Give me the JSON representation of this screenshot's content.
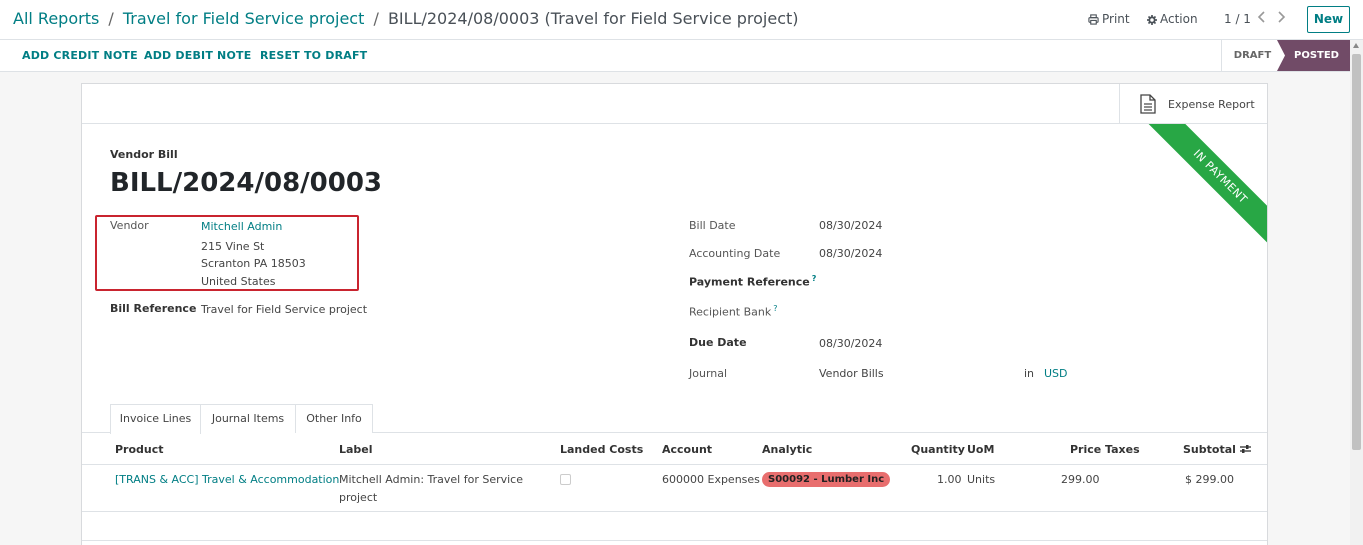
{
  "breadcrumb": {
    "root": "All Reports",
    "parent": "Travel for Field Service project",
    "current": "BILL/2024/08/0003 (Travel for Field Service project)",
    "separator": "/"
  },
  "toolbar": {
    "print_label": "Print",
    "action_label": "Action",
    "pager": "1 / 1",
    "new_label": "New"
  },
  "statusbar": {
    "actions": [
      "ADD CREDIT NOTE",
      "ADD DEBIT NOTE",
      "RESET TO DRAFT"
    ],
    "stages": [
      "DRAFT",
      "POSTED"
    ],
    "active_stage": "POSTED"
  },
  "smart_button": {
    "label": "Expense Report",
    "icon": "document-icon"
  },
  "ribbon": "IN PAYMENT",
  "document": {
    "type": "Vendor Bill",
    "name": "BILL/2024/08/0003"
  },
  "vendor": {
    "label": "Vendor",
    "name": "Mitchell Admin",
    "street": "215 Vine St",
    "city": "Scranton PA 18503",
    "country": "United States"
  },
  "bill_reference": {
    "label": "Bill Reference",
    "value": "Travel for Field Service project"
  },
  "right_fields": {
    "bill_date": {
      "label": "Bill Date",
      "value": "08/30/2024"
    },
    "accounting_date": {
      "label": "Accounting Date",
      "value": "08/30/2024"
    },
    "payment_reference": {
      "label": "Payment Reference",
      "help": "?"
    },
    "recipient_bank": {
      "label": "Recipient Bank",
      "help": "?"
    },
    "due_date": {
      "label": "Due Date",
      "value": "08/30/2024"
    },
    "journal": {
      "label": "Journal",
      "value": "Vendor Bills",
      "in": "in",
      "currency": "USD"
    }
  },
  "tabs": [
    "Invoice Lines",
    "Journal Items",
    "Other Info"
  ],
  "active_tab": "Invoice Lines",
  "table": {
    "columns": [
      "Product",
      "Label",
      "Landed Costs",
      "Account",
      "Analytic",
      "Quantity",
      "UoM",
      "Price",
      "Taxes",
      "Subtotal"
    ],
    "rows": [
      {
        "product": "[TRANS & ACC] Travel & Accommodation",
        "label_line1": "Mitchell Admin: Travel for Service",
        "label_line2": "project",
        "landed_costs": false,
        "account": "600000 Expenses",
        "analytic": "S00092 - Lumber Inc",
        "quantity": "1.00",
        "uom": "Units",
        "price": "299.00",
        "taxes": "",
        "subtotal": "$ 299.00"
      }
    ]
  },
  "colors": {
    "accent": "#017e84",
    "stage_active": "#714b67",
    "ribbon": "#28a745",
    "analytic_tag": "#e86e6e",
    "highlight": "#c9242f"
  }
}
